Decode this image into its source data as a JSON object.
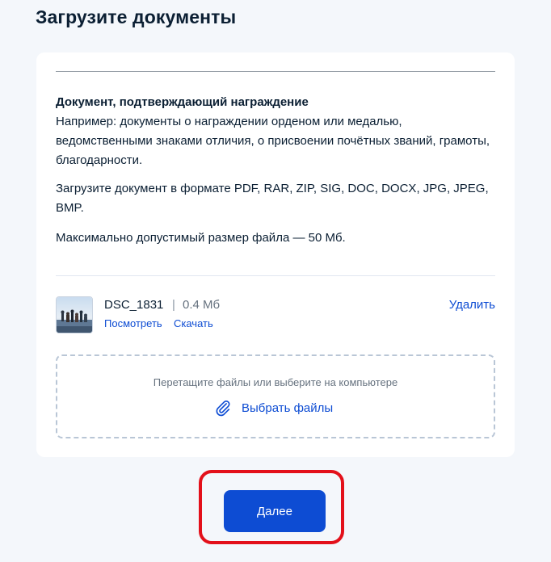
{
  "page": {
    "title": "Загрузите документы"
  },
  "document": {
    "heading": "Документ, подтверждающий награждение",
    "example": "Например: документы о награждении орденом или медалью, ведомственными знаками отличия, о присвоении почётных званий, грамоты, благодарности.",
    "formats": "Загрузите документ в формате PDF, RAR, ZIP, SIG, DOC, DOCX, JPG, JPEG, BMP.",
    "max_size": "Максимально допустимый размер файла — 50 Мб."
  },
  "file": {
    "name": "DSC_1831",
    "separator": "|",
    "size": "0.4 Мб",
    "view_label": "Посмотреть",
    "download_label": "Скачать",
    "delete_label": "Удалить",
    "thumbnail_icon": "photo-thumbnail"
  },
  "dropzone": {
    "hint": "Перетащите файлы или выберите на компьютере",
    "choose_label": "Выбрать файлы",
    "icon": "paperclip-icon"
  },
  "actions": {
    "next_label": "Далее"
  },
  "colors": {
    "accent": "#0d4cd3",
    "highlight_frame": "#e3101a",
    "background": "#f4f7fb",
    "text": "#0b1f33",
    "muted": "#66727f"
  }
}
